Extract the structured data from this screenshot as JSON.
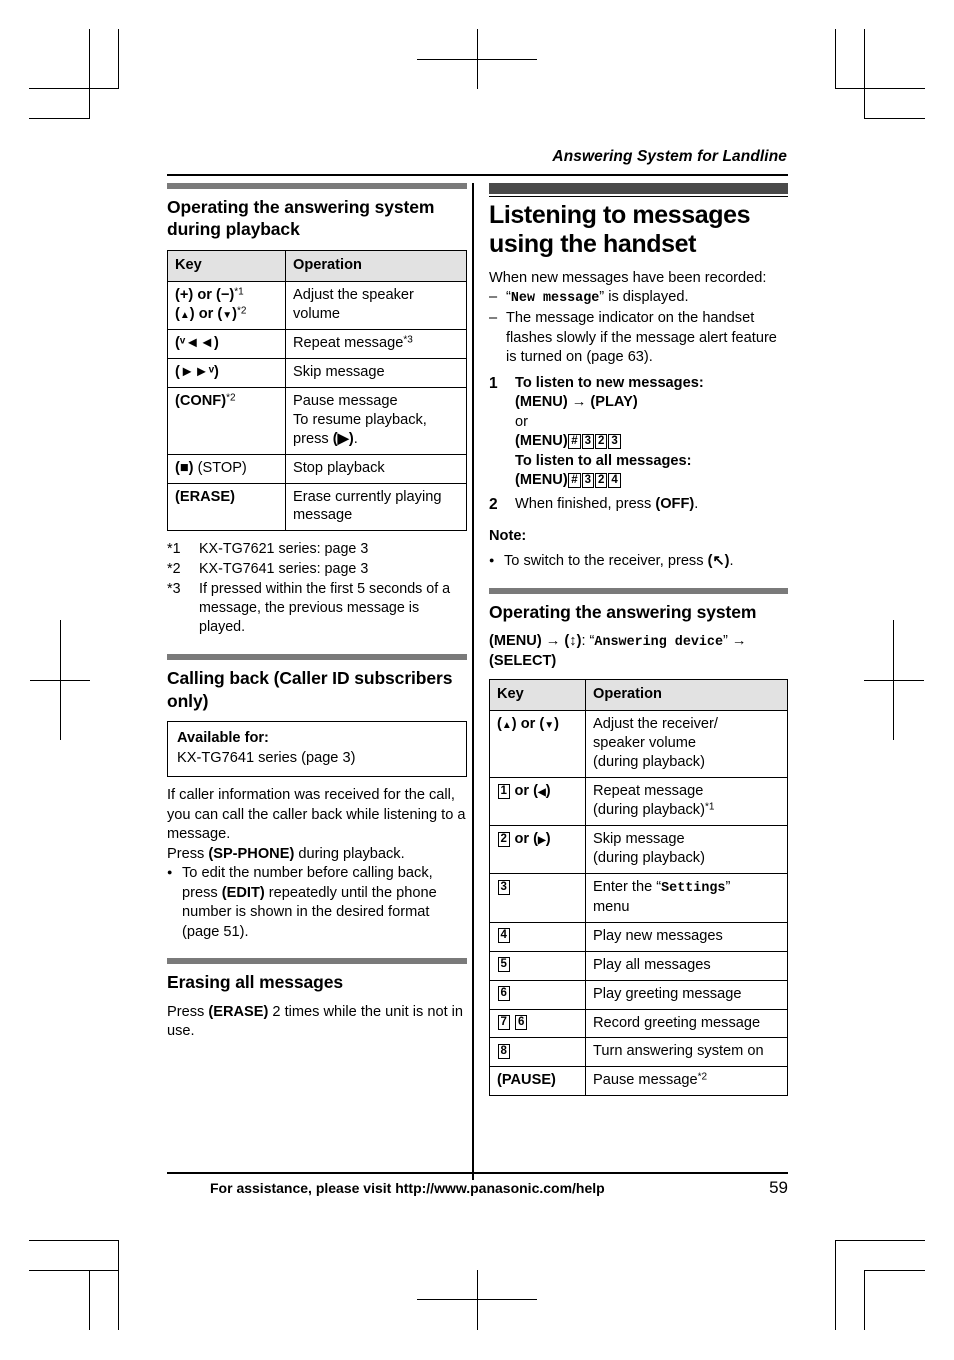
{
  "running_head": "Answering System for Landline",
  "footer": {
    "assistance": "For assistance, please visit http://www.panasonic.com/help",
    "page_number": "59"
  },
  "left_column": {
    "section1": {
      "heading": "Operating the answering system during playback",
      "table": {
        "headers": [
          "Key",
          "Operation"
        ],
        "rows": [
          {
            "key_line1_a": "(",
            "key_line1_plus": "+",
            "key_line1_b": ") or (",
            "key_line1_minus": "−",
            "key_line1_c": ")",
            "key_fn1": "*1",
            "key_line2_a": "(",
            "key_line2_up": "▲",
            "key_line2_b": ") or (",
            "key_line2_down": "▼",
            "key_line2_c": ")",
            "key_fn2": "*2",
            "op_line1": "Adjust the speaker",
            "op_line2": "volume"
          },
          {
            "key": "(ᵛ◄◄)",
            "op": "Repeat message",
            "op_fn": "*3"
          },
          {
            "key": "(►►ᵛ)",
            "op": "Skip message"
          },
          {
            "key": "(CONF)",
            "key_fn": "*2",
            "op_line1": "Pause message",
            "op_line2": "To resume playback,",
            "op_line3_pre": "press ",
            "op_line3_key": "(▶)",
            "op_line3_post": "."
          },
          {
            "key_bold": "(■)",
            "key_plain": " (STOP)",
            "op": "Stop playback"
          },
          {
            "key": "(ERASE)",
            "op_line1": "Erase currently playing",
            "op_line2": "message"
          }
        ]
      },
      "footnotes": [
        {
          "mark": "*1",
          "text": "KX-TG7621 series: page 3"
        },
        {
          "mark": "*2",
          "text": "KX-TG7641 series: page 3"
        },
        {
          "mark": "*3",
          "text": "If pressed within the first 5 seconds of a message, the previous message is played."
        }
      ]
    },
    "section2": {
      "heading": "Calling back (Caller ID subscribers only)",
      "available_box": {
        "title": "Available for:",
        "value": "KX-TG7641 series (page 3)"
      },
      "paragraph": "If caller information was received for the call, you can call the caller back while listening to a message.",
      "press_pre": "Press ",
      "press_key": "(SP-PHONE)",
      "press_post": " during playback.",
      "bullet_part1": "To edit the number before calling back, press ",
      "bullet_key": "(EDIT)",
      "bullet_part2": " repeatedly until the phone number is shown in the desired format (page 51)."
    },
    "section3": {
      "heading": "Erasing all messages",
      "press_pre": "Press ",
      "press_key": "(ERASE)",
      "press_post": " 2 times while the unit is not in use."
    }
  },
  "right_column": {
    "chapter_heading": "Listening to messages using the handset",
    "intro": "When new messages have been recorded:",
    "dash_items": [
      {
        "pre": "“",
        "mono": "New message",
        "post": "” is displayed."
      },
      {
        "plain": "The message indicator on the handset flashes slowly if the message alert feature is turned on (page 63)."
      }
    ],
    "steps": [
      {
        "num": "1",
        "line1": "To listen to new messages:",
        "line2_key1": "(MENU)",
        "line2_arrow": "→",
        "line2_key2": "(PLAY)",
        "line3": "or",
        "line4_key": "(MENU)",
        "line4_caps": [
          "#",
          "3",
          "2",
          "3"
        ],
        "line5": "To listen to all messages:",
        "line6_key": "(MENU)",
        "line6_caps": [
          "#",
          "3",
          "2",
          "4"
        ]
      },
      {
        "num": "2",
        "pre": "When finished, press ",
        "key": "(OFF)",
        "post": "."
      }
    ],
    "note_label": "Note:",
    "note_pre": "To switch to the receiver, press ",
    "note_key": "(↖)",
    "note_post": ".",
    "section_heading": "Operating the answering system",
    "nav_line_key1": "(MENU)",
    "nav_arrow1": "→",
    "nav_key2": "(↕)",
    "nav_colon": ": “",
    "nav_mono": "Answering device",
    "nav_quote_close": "” ",
    "nav_arrow2": "→",
    "nav_key3": "(SELECT)",
    "table": {
      "headers": [
        "Key",
        "Operation"
      ],
      "rows": [
        {
          "key_a": "(",
          "key_up": "▲",
          "key_b": ") or (",
          "key_down": "▼",
          "key_c": ")",
          "op_line1": "Adjust the receiver/",
          "op_line2": "speaker volume",
          "op_line3": "(during playback)"
        },
        {
          "cap": "1",
          "key_mid": " or (",
          "key_arrow": "◀",
          "key_end": ")",
          "op_line1": "Repeat message",
          "op_line2": "(during playback)",
          "op_fn": "*1"
        },
        {
          "cap": "2",
          "key_mid": " or (",
          "key_arrow": "▶",
          "key_end": ")",
          "op_line1": "Skip message",
          "op_line2": "(during playback)"
        },
        {
          "cap": "3",
          "op_pre": "Enter the “",
          "op_mono": "Settings",
          "op_post": "”",
          "op_line2": "menu"
        },
        {
          "cap": "4",
          "op": "Play new messages"
        },
        {
          "cap": "5",
          "op": "Play all messages"
        },
        {
          "cap": "6",
          "op": "Play greeting message"
        },
        {
          "cap": "7",
          "cap2": "6",
          "op": "Record greeting message"
        },
        {
          "cap": "8",
          "op": "Turn answering system on"
        },
        {
          "key": "(PAUSE)",
          "op": "Pause message",
          "op_fn": "*2"
        }
      ]
    }
  }
}
